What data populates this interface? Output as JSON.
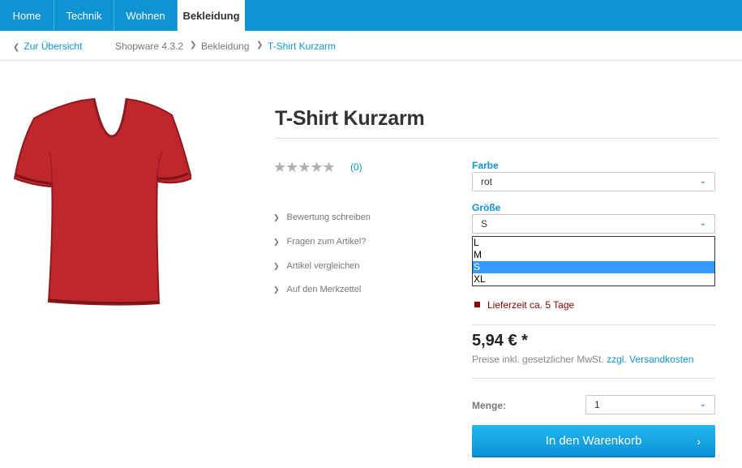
{
  "nav": {
    "tabs": [
      {
        "label": "Home"
      },
      {
        "label": "Technik"
      },
      {
        "label": "Wohnen"
      },
      {
        "label": "Bekleidung"
      }
    ],
    "active_index": 3
  },
  "breadcrumb": {
    "back_label": "Zur Übersicht",
    "items": [
      "Shopware 4.3.2",
      "Bekleidung",
      "T-Shirt Kurzarm"
    ]
  },
  "product": {
    "title": "T-Shirt Kurzarm",
    "rating_stars": "★★★★★",
    "rating_count": "(0)",
    "actions": [
      {
        "label": "Bewertung schreiben"
      },
      {
        "label": "Fragen zum Artikel?"
      },
      {
        "label": "Artikel vergleichen"
      },
      {
        "label": "Auf den Merkzettel"
      }
    ]
  },
  "configurator": {
    "color_label": "Farbe",
    "color_value": "rot",
    "size_label": "Größe",
    "size_value": "S",
    "size_options": [
      "L",
      "M",
      "S",
      "XL"
    ],
    "size_selected_index": 2
  },
  "delivery": {
    "text": "Lieferzeit ca. 5 Tage",
    "color": "#8b0000"
  },
  "price": {
    "value": "5,94 € *",
    "note_prefix": "Preise inkl. gesetzlicher MwSt.",
    "note_link": "zzgl. Versandkosten"
  },
  "quantity": {
    "label": "Menge:",
    "value": "1"
  },
  "cart": {
    "label": "In den Warenkorb"
  },
  "colors": {
    "accent": "#0e93d3",
    "product": "#c0272d"
  }
}
